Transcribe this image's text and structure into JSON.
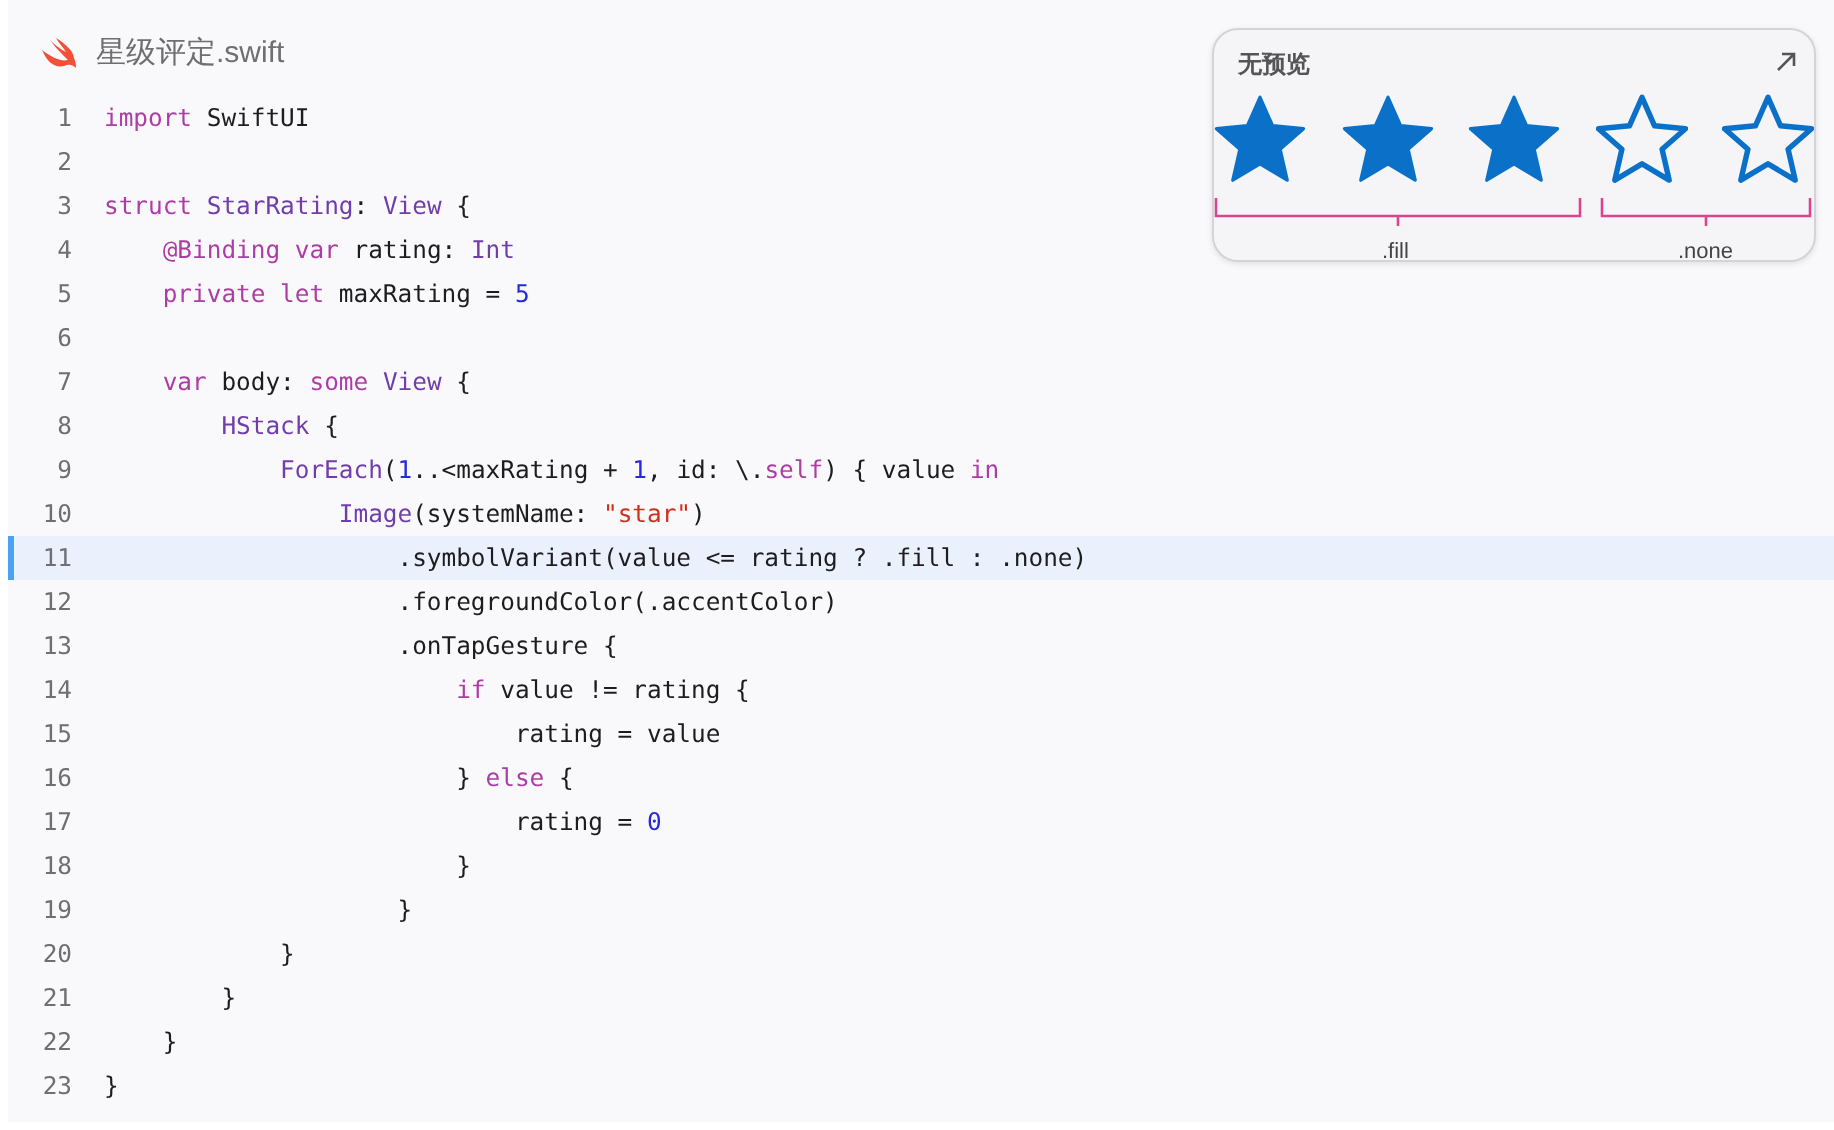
{
  "file": {
    "name": "星级评定.swift"
  },
  "code": {
    "lines": [
      {
        "number": "1",
        "highlighted": false,
        "tokens": [
          {
            "text": "import",
            "kind": "keyword"
          },
          {
            "text": " SwiftUI",
            "kind": "plain"
          }
        ]
      },
      {
        "number": "2",
        "highlighted": false
      },
      {
        "number": "3",
        "highlighted": false,
        "tokens": [
          {
            "text": "struct",
            "kind": "keyword"
          },
          {
            "text": " StarRating",
            "kind": "type"
          },
          {
            "text": ": ",
            "kind": "plain"
          },
          {
            "text": "View",
            "kind": "type"
          },
          {
            "text": " {",
            "kind": "plain"
          }
        ]
      },
      {
        "number": "4",
        "highlighted": false,
        "tokens": [
          {
            "text": "    @Binding",
            "kind": "keyword"
          },
          {
            "text": " var",
            "kind": "keyword"
          },
          {
            "text": " rating: ",
            "kind": "plain"
          },
          {
            "text": "Int",
            "kind": "type"
          }
        ]
      },
      {
        "number": "5",
        "highlighted": false,
        "tokens": [
          {
            "text": "    private",
            "kind": "keyword"
          },
          {
            "text": " let",
            "kind": "keyword"
          },
          {
            "text": " maxRating = ",
            "kind": "plain"
          },
          {
            "text": "5",
            "kind": "number"
          }
        ]
      },
      {
        "number": "6",
        "highlighted": false
      },
      {
        "number": "7",
        "highlighted": false,
        "tokens": [
          {
            "text": "    var",
            "kind": "keyword"
          },
          {
            "text": " body: ",
            "kind": "plain"
          },
          {
            "text": "some",
            "kind": "keyword"
          },
          {
            "text": " View",
            "kind": "type"
          },
          {
            "text": " {",
            "kind": "plain"
          }
        ]
      },
      {
        "number": "8",
        "highlighted": false,
        "tokens": [
          {
            "text": "        HStack",
            "kind": "type"
          },
          {
            "text": " {",
            "kind": "plain"
          }
        ]
      },
      {
        "number": "9",
        "highlighted": false,
        "tokens": [
          {
            "text": "            ForEach",
            "kind": "type"
          },
          {
            "text": "(",
            "kind": "plain"
          },
          {
            "text": "1",
            "kind": "number"
          },
          {
            "text": "..<maxRating + ",
            "kind": "plain"
          },
          {
            "text": "1",
            "kind": "number"
          },
          {
            "text": ", id: \\.",
            "kind": "plain"
          },
          {
            "text": "self",
            "kind": "keyword"
          },
          {
            "text": ") { value ",
            "kind": "plain"
          },
          {
            "text": "in",
            "kind": "keyword"
          }
        ]
      },
      {
        "number": "10",
        "highlighted": false,
        "tokens": [
          {
            "text": "                Image",
            "kind": "type"
          },
          {
            "text": "(systemName: ",
            "kind": "plain"
          },
          {
            "text": "\"star\"",
            "kind": "string"
          },
          {
            "text": ")",
            "kind": "plain"
          }
        ]
      },
      {
        "number": "11",
        "highlighted": true,
        "tokens": [
          {
            "text": "                    .symbolVariant(value <= rating ? .fill : .none)",
            "kind": "plain"
          }
        ]
      },
      {
        "number": "12",
        "highlighted": false,
        "tokens": [
          {
            "text": "                    .foregroundColor(.accentColor)",
            "kind": "plain"
          }
        ]
      },
      {
        "number": "13",
        "highlighted": false,
        "tokens": [
          {
            "text": "                    .onTapGesture {",
            "kind": "plain"
          }
        ]
      },
      {
        "number": "14",
        "highlighted": false,
        "tokens": [
          {
            "text": "                        if",
            "kind": "keyword"
          },
          {
            "text": " value != rating {",
            "kind": "plain"
          }
        ]
      },
      {
        "number": "15",
        "highlighted": false,
        "tokens": [
          {
            "text": "                            rating = value",
            "kind": "plain"
          }
        ]
      },
      {
        "number": "16",
        "highlighted": false,
        "tokens": [
          {
            "text": "                        } ",
            "kind": "plain"
          },
          {
            "text": "else",
            "kind": "keyword"
          },
          {
            "text": " {",
            "kind": "plain"
          }
        ]
      },
      {
        "number": "17",
        "highlighted": false,
        "tokens": [
          {
            "text": "                            rating = ",
            "kind": "plain"
          },
          {
            "text": "0",
            "kind": "number"
          }
        ]
      },
      {
        "number": "18",
        "highlighted": false,
        "tokens": [
          {
            "text": "                        }",
            "kind": "plain"
          }
        ]
      },
      {
        "number": "19",
        "highlighted": false,
        "tokens": [
          {
            "text": "                    }",
            "kind": "plain"
          }
        ]
      },
      {
        "number": "20",
        "highlighted": false,
        "tokens": [
          {
            "text": "            }",
            "kind": "plain"
          }
        ]
      },
      {
        "number": "21",
        "highlighted": false,
        "tokens": [
          {
            "text": "        }",
            "kind": "plain"
          }
        ]
      },
      {
        "number": "22",
        "highlighted": false,
        "tokens": [
          {
            "text": "    }",
            "kind": "plain"
          }
        ]
      },
      {
        "number": "23",
        "highlighted": false,
        "tokens": [
          {
            "text": "}",
            "kind": "plain"
          }
        ]
      }
    ]
  },
  "preview": {
    "title": "无预览",
    "stars": 3,
    "fill_label": ".fill",
    "none_label": ".none"
  }
}
